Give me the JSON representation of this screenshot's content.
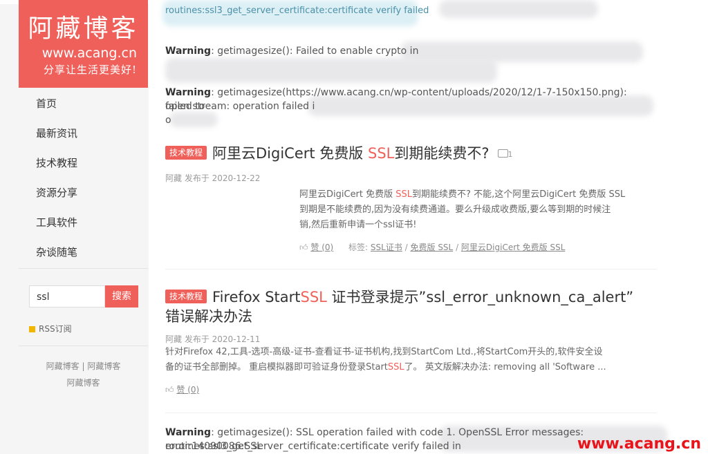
{
  "sidebar": {
    "logo_cn": "阿藏博客",
    "logo_url": "www.acang.cn",
    "logo_slogan": "分享让生活更美好!",
    "nav": [
      "首页",
      "最新资讯",
      "技术教程",
      "资源分享",
      "工具软件",
      "杂谈随笔"
    ],
    "search_value": "ssl",
    "search_button": "搜索",
    "rss": "RSS订阅",
    "footer_line1": "阿藏博客 | 阿藏博客",
    "footer_line2": "阿藏博客"
  },
  "main": {
    "top_error": "routines:ssl3_get_server_certificate:certificate verify failed",
    "warn1_label": "Warning",
    "warn1_text": ": getimagesize(): Failed to enable crypto in",
    "warn2_label": "Warning",
    "warn2_text": ": getimagesize(https://www.acang.cn/wp-content/uploads/2020/12/1-7-150x150.png): failed to",
    "warn2_line2": "open stream: operation failed i",
    "warn2_line3": "o",
    "post1": {
      "tag": "技术教程",
      "title_before": "阿里云DigiCert 免费版 ",
      "title_hl": "SSL",
      "title_after": "到期能续费不?",
      "img_count": "1",
      "meta": "阿藏 发布于 2020-12-22",
      "excerpt_l1a": "阿里云DigiCert 免费版 ",
      "excerpt_l1hl": "SSL",
      "excerpt_l1b": "到期能续费不?  不能,这个阿里云DigiCert 免费版 SSL",
      "excerpt_l2": "到期是不能续费的,因为没有续费通道。要么升级成收费版,要么等到期的时候注",
      "excerpt_l3": "销,然后重新申请一个ssl证书!",
      "like": "赞 (0)",
      "tags_label": "标签:",
      "tags": [
        "SSL证书",
        "免费版 SSL",
        "阿里云DigiCert 免费版 SSL"
      ]
    },
    "post2": {
      "tag": "技术教程",
      "title_l1a": "Firefox Start",
      "title_l1hl": "SSL",
      "title_l1b": " 证书登录提示”ssl_error_unknown_ca_alert”",
      "title_l2": "错误解决办法",
      "meta": "阿藏 发布于 2020-12-11",
      "excerpt_l1": "针对Firefox 42,工具-选项-高级-证书-查看证书-证书机构,找到StartCom Ltd.,将StartCom开头的,软件安全设",
      "excerpt_l2a": "备的证书全部删掉。 重启模拟器即可验证身份登录Start",
      "excerpt_l2hl": "SSL",
      "excerpt_l2b": "了。 英文版解决办法: removing all 'Software ...",
      "like": "赞 (0)"
    },
    "warn3_label": "Warning",
    "warn3_text": ": getimagesize(): SSL operation failed with code 1. OpenSSL Error messages: error:14090086:SSL",
    "warn3_line2": "routines:ssl3_get_server_certificate:certificate verify failed in",
    "watermark": "www.acang.cn"
  },
  "colors": {
    "accent": "#f0605a",
    "watermark": "#e8141b"
  }
}
